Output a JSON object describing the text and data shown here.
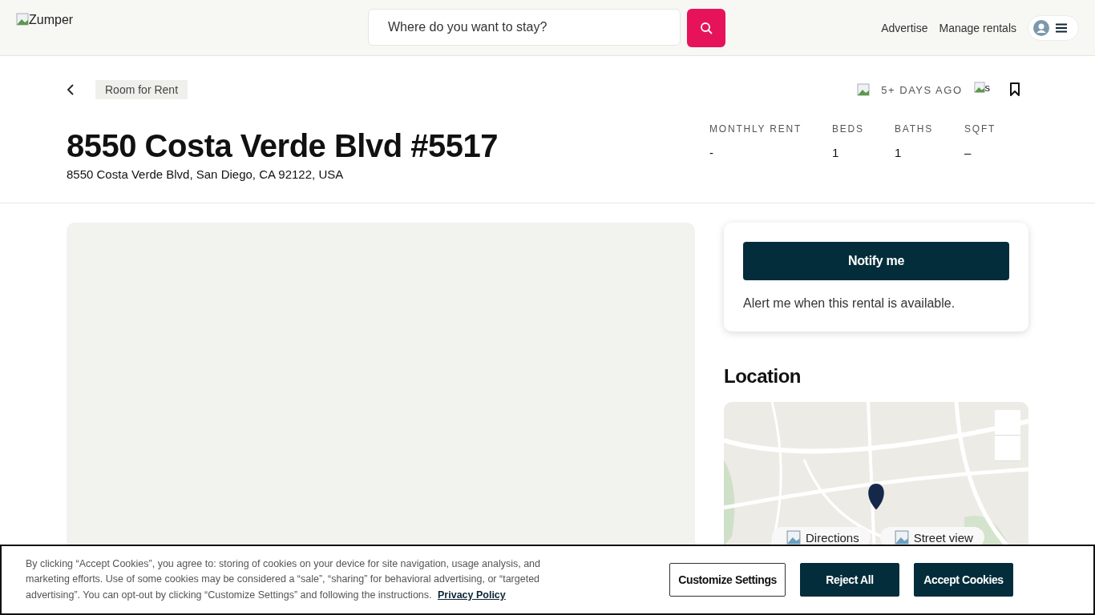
{
  "header": {
    "logo_alt": "Zumper",
    "search": {
      "placeholder": "Where do you want to stay?"
    },
    "nav": [
      "Advertise",
      "Manage rentals"
    ]
  },
  "listing": {
    "tag": "Room for Rent",
    "posted": "5+ DAYS AGO",
    "share_alt": "s",
    "saved": false,
    "title": "8550 Costa Verde Blvd #5517",
    "address": "8550 Costa Verde Blvd, San Diego, CA 92122, USA",
    "stats": [
      {
        "label": "MONTHLY RENT",
        "value": "-"
      },
      {
        "label": "BEDS",
        "value": "1"
      },
      {
        "label": "BATHS",
        "value": "1"
      },
      {
        "label": "SQFT",
        "value": "–"
      }
    ]
  },
  "notify": {
    "button": "Notify me",
    "text": "Alert me when this rental is available."
  },
  "location": {
    "heading": "Location",
    "map": {
      "kind": "picture"
    },
    "actions": [
      "Directions",
      "Street view"
    ]
  },
  "cookies": {
    "text": "By clicking “Accept Cookies”, you agree to: storing of cookies on your device for site navigation, usage analysis, and marketing efforts. Use of some cookies may be considered a “sale”, “sharing” for behavioral advertising, or “targeted advertising”. You can opt-out by clicking “Customize Settings” and following the instructions.",
    "link": "Privacy Policy",
    "buttons": [
      {
        "label": "Customize Settings",
        "kind": "outline"
      },
      {
        "label": "Reject All",
        "kind": "solid"
      },
      {
        "label": "Accept Cookies",
        "kind": "solid"
      }
    ]
  }
}
